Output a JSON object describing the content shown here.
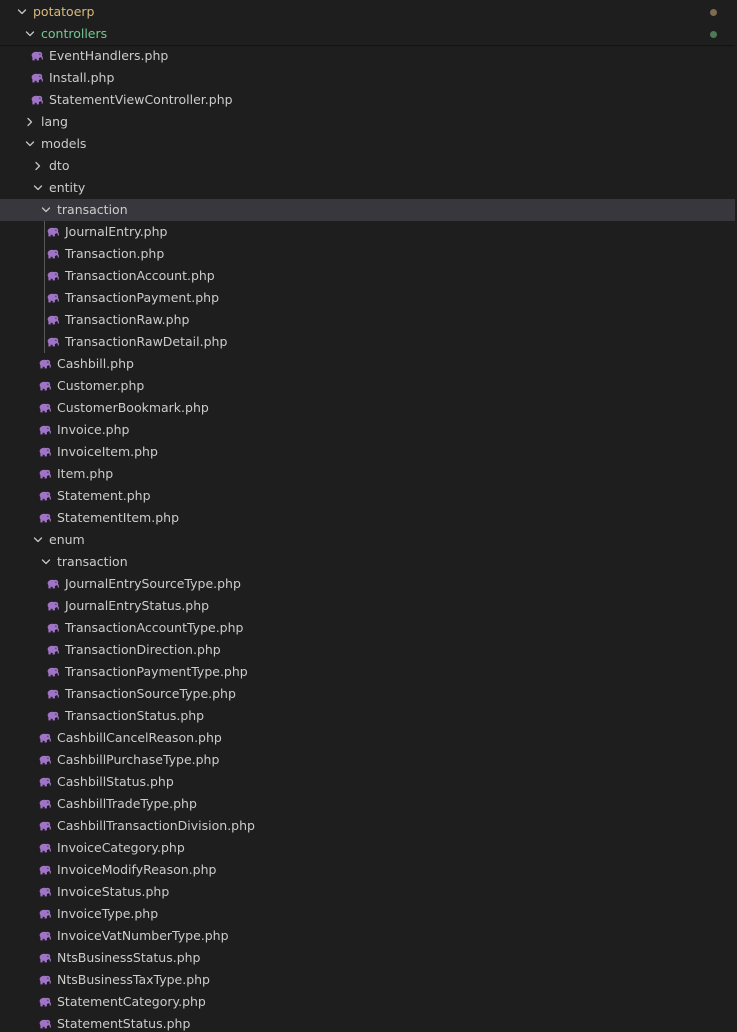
{
  "colors": {
    "background": "#1e1e1e",
    "selected_row": "#37373d",
    "root_folder_text": "#d7ba7d",
    "controllers_text": "#73c991",
    "default_text": "#cccccc",
    "php_icon": "#a074c4",
    "root_dot": "#7f6b51",
    "controllers_dot": "#4b7a55"
  },
  "icons": {
    "expanded": "chevron-down-icon",
    "collapsed": "chevron-right-icon",
    "file": "php-elephant-icon"
  },
  "tree": [
    {
      "label": "potatoerp",
      "type": "folder",
      "expanded": true,
      "depth": 0,
      "color": "#d7ba7d",
      "dot": "#7f6b51",
      "sticky": true
    },
    {
      "label": "controllers",
      "type": "folder",
      "expanded": true,
      "depth": 1,
      "color": "#73c991",
      "dot": "#4b7a55",
      "sticky": true
    },
    {
      "label": "EventHandlers.php",
      "type": "file",
      "depth": 2
    },
    {
      "label": "Install.php",
      "type": "file",
      "depth": 2
    },
    {
      "label": "StatementViewController.php",
      "type": "file",
      "depth": 2
    },
    {
      "label": "lang",
      "type": "folder",
      "expanded": false,
      "depth": 1
    },
    {
      "label": "models",
      "type": "folder",
      "expanded": true,
      "depth": 1
    },
    {
      "label": "dto",
      "type": "folder",
      "expanded": false,
      "depth": 2
    },
    {
      "label": "entity",
      "type": "folder",
      "expanded": true,
      "depth": 2
    },
    {
      "label": "transaction",
      "type": "folder",
      "expanded": true,
      "depth": 3,
      "selected": true
    },
    {
      "label": "JournalEntry.php",
      "type": "file",
      "depth": 4
    },
    {
      "label": "Transaction.php",
      "type": "file",
      "depth": 4
    },
    {
      "label": "TransactionAccount.php",
      "type": "file",
      "depth": 4
    },
    {
      "label": "TransactionPayment.php",
      "type": "file",
      "depth": 4
    },
    {
      "label": "TransactionRaw.php",
      "type": "file",
      "depth": 4
    },
    {
      "label": "TransactionRawDetail.php",
      "type": "file",
      "depth": 4
    },
    {
      "label": "Cashbill.php",
      "type": "file",
      "depth": 3
    },
    {
      "label": "Customer.php",
      "type": "file",
      "depth": 3
    },
    {
      "label": "CustomerBookmark.php",
      "type": "file",
      "depth": 3
    },
    {
      "label": "Invoice.php",
      "type": "file",
      "depth": 3
    },
    {
      "label": "InvoiceItem.php",
      "type": "file",
      "depth": 3
    },
    {
      "label": "Item.php",
      "type": "file",
      "depth": 3
    },
    {
      "label": "Statement.php",
      "type": "file",
      "depth": 3
    },
    {
      "label": "StatementItem.php",
      "type": "file",
      "depth": 3
    },
    {
      "label": "enum",
      "type": "folder",
      "expanded": true,
      "depth": 2
    },
    {
      "label": "transaction",
      "type": "folder",
      "expanded": true,
      "depth": 3
    },
    {
      "label": "JournalEntrySourceType.php",
      "type": "file",
      "depth": 4
    },
    {
      "label": "JournalEntryStatus.php",
      "type": "file",
      "depth": 4
    },
    {
      "label": "TransactionAccountType.php",
      "type": "file",
      "depth": 4
    },
    {
      "label": "TransactionDirection.php",
      "type": "file",
      "depth": 4
    },
    {
      "label": "TransactionPaymentType.php",
      "type": "file",
      "depth": 4
    },
    {
      "label": "TransactionSourceType.php",
      "type": "file",
      "depth": 4
    },
    {
      "label": "TransactionStatus.php",
      "type": "file",
      "depth": 4
    },
    {
      "label": "CashbillCancelReason.php",
      "type": "file",
      "depth": 3
    },
    {
      "label": "CashbillPurchaseType.php",
      "type": "file",
      "depth": 3
    },
    {
      "label": "CashbillStatus.php",
      "type": "file",
      "depth": 3
    },
    {
      "label": "CashbillTradeType.php",
      "type": "file",
      "depth": 3
    },
    {
      "label": "CashbillTransactionDivision.php",
      "type": "file",
      "depth": 3
    },
    {
      "label": "InvoiceCategory.php",
      "type": "file",
      "depth": 3
    },
    {
      "label": "InvoiceModifyReason.php",
      "type": "file",
      "depth": 3
    },
    {
      "label": "InvoiceStatus.php",
      "type": "file",
      "depth": 3
    },
    {
      "label": "InvoiceType.php",
      "type": "file",
      "depth": 3
    },
    {
      "label": "InvoiceVatNumberType.php",
      "type": "file",
      "depth": 3
    },
    {
      "label": "NtsBusinessStatus.php",
      "type": "file",
      "depth": 3
    },
    {
      "label": "NtsBusinessTaxType.php",
      "type": "file",
      "depth": 3
    },
    {
      "label": "StatementCategory.php",
      "type": "file",
      "depth": 3
    },
    {
      "label": "StatementStatus.php",
      "type": "file",
      "depth": 3
    }
  ]
}
